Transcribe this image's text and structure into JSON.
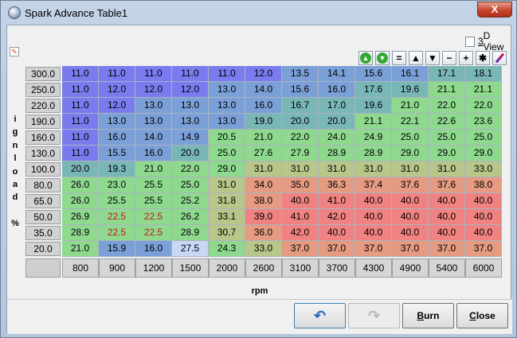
{
  "window": {
    "title": "Spark Advance Table1",
    "close_glyph": "X"
  },
  "options": {
    "view3d_label_u": "3",
    "view3d_label_rest": "D View",
    "view3d_checked": false
  },
  "axes": {
    "y_label_letters": [
      "i",
      "g",
      "n",
      "l",
      "o",
      "a",
      "d",
      "",
      "%"
    ],
    "x_label": "rpm",
    "y_values": [
      "300.0",
      "250.0",
      "220.0",
      "190.0",
      "160.0",
      "130.0",
      "100.0",
      "80.0",
      "65.0",
      "50.0",
      "35.0",
      "20.0"
    ],
    "x_values": [
      "800",
      "900",
      "1200",
      "1500",
      "2000",
      "2600",
      "3100",
      "3700",
      "4300",
      "4900",
      "5400",
      "6000"
    ]
  },
  "toolbar": {
    "buttons": [
      {
        "name": "go-up-icon",
        "glyph": "▲",
        "style": "green"
      },
      {
        "name": "go-down-icon",
        "glyph": "▼",
        "style": "green"
      },
      {
        "name": "equals-button",
        "glyph": "=",
        "style": "plain"
      },
      {
        "name": "increase-button",
        "glyph": "▲",
        "style": "plain"
      },
      {
        "name": "decrease-button",
        "glyph": "▼",
        "style": "plain"
      },
      {
        "name": "minus-button",
        "glyph": "−",
        "style": "plain"
      },
      {
        "name": "plus-button",
        "glyph": "+",
        "style": "plain"
      },
      {
        "name": "multiply-button",
        "glyph": "✱",
        "style": "plain"
      },
      {
        "name": "pen-icon",
        "glyph": "",
        "style": "pen"
      }
    ]
  },
  "table": {
    "rows": [
      [
        "11.0",
        "11.0",
        "11.0",
        "11.0",
        "11.0",
        "12.0",
        "13.5",
        "14.1",
        "15.6",
        "16.1",
        "17.1",
        "18.1"
      ],
      [
        "11.0",
        "12.0",
        "12.0",
        "12.0",
        "13.0",
        "14.0",
        "15.6",
        "16.0",
        "17.6",
        "19.6",
        "21.1",
        "21.1"
      ],
      [
        "11.0",
        "12.0",
        "13.0",
        "13.0",
        "13.0",
        "16.0",
        "16.7",
        "17.0",
        "19.6",
        "21.0",
        "22.0",
        "22.0"
      ],
      [
        "11.0",
        "13.0",
        "13.0",
        "13.0",
        "13.0",
        "19.0",
        "20.0",
        "20.0",
        "21.1",
        "22.1",
        "22.6",
        "23.6"
      ],
      [
        "11.0",
        "16.0",
        "14.0",
        "14.9",
        "20.5",
        "21.0",
        "22.0",
        "24.0",
        "24.9",
        "25.0",
        "25.0",
        "25.0"
      ],
      [
        "11.0",
        "15.5",
        "16.0",
        "20.0",
        "25.0",
        "27.6",
        "27.9",
        "28.9",
        "28.9",
        "29.0",
        "29.0",
        "29.0"
      ],
      [
        "20.0",
        "19.3",
        "21.0",
        "22.0",
        "29.0",
        "31.0",
        "31.0",
        "31.0",
        "31.0",
        "31.0",
        "31.0",
        "33.0"
      ],
      [
        "26.0",
        "23.0",
        "25.5",
        "25.0",
        "31.0",
        "34.0",
        "35.0",
        "36.3",
        "37.4",
        "37.6",
        "37.6",
        "38.0"
      ],
      [
        "26.0",
        "25.5",
        "25.5",
        "25.2",
        "31.8",
        "38.0",
        "40.0",
        "41.0",
        "40.0",
        "40.0",
        "40.0",
        "40.0"
      ],
      [
        "26.9",
        "22.5",
        "22.5",
        "26.2",
        "33.1",
        "39.0",
        "41.0",
        "42.0",
        "40.0",
        "40.0",
        "40.0",
        "40.0"
      ],
      [
        "28.9",
        "22.5",
        "22.5",
        "28.9",
        "30.7",
        "36.0",
        "42.0",
        "40.0",
        "40.0",
        "40.0",
        "40.0",
        "40.0"
      ],
      [
        "21.0",
        "15.9",
        "16.0",
        "27.5",
        "24.3",
        "33.0",
        "37.0",
        "37.0",
        "37.0",
        "37.0",
        "37.0",
        "37.0"
      ]
    ],
    "red_cells": [
      [
        9,
        1
      ],
      [
        9,
        2
      ],
      [
        10,
        1
      ],
      [
        10,
        2
      ]
    ],
    "selected_cell": [
      11,
      3
    ],
    "colors": {
      "low": "#7b7bf0",
      "mid_blue": "#7ba0d8",
      "teal": "#79b7b6",
      "green": "#8fd98f",
      "olive": "#b9c68a",
      "salmon": "#e59a82",
      "red": "#f08282",
      "selected": "#c6d8f3",
      "red_text": "#c01818"
    }
  },
  "buttons": {
    "undo_glyph": "↶",
    "redo_glyph": "↷",
    "burn_u": "B",
    "burn_rest": "urn",
    "close_u": "C",
    "close_rest": "lose"
  }
}
